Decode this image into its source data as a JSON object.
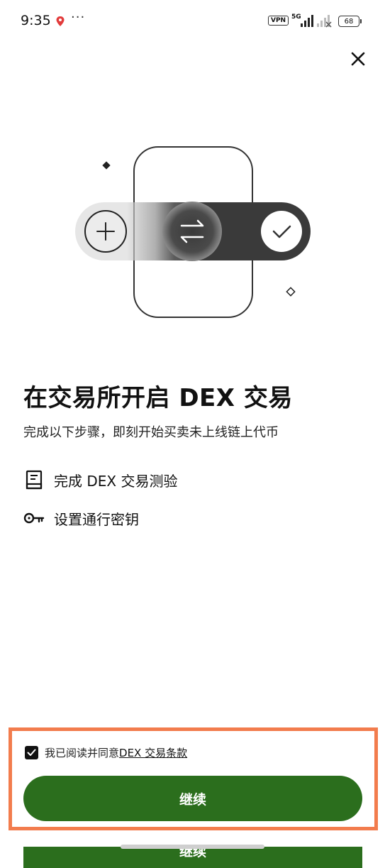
{
  "status_bar": {
    "time": "9:35",
    "dots": "···",
    "vpn_label": "VPN",
    "network_label": "5G",
    "battery": "68"
  },
  "icons": {
    "close": "close-icon",
    "plus": "plus-icon",
    "swap": "swap-arrows-icon",
    "check": "check-icon",
    "quiz": "document-icon",
    "passkey": "key-icon"
  },
  "main": {
    "headline": "在交易所开启 DEX 交易",
    "subtitle": "完成以下步骤，即刻开始买卖未上线链上代币",
    "steps": [
      {
        "label": "完成 DEX 交易测验"
      },
      {
        "label": "设置通行密钥"
      }
    ]
  },
  "footer": {
    "agree_prefix": "我已阅读并同意",
    "agree_link": "DEX 交易条款",
    "agree_checked": true,
    "continue_label": "继续",
    "ghost_label": "继续"
  },
  "colors": {
    "primary_green": "#2b6e1d",
    "highlight_border": "#f27c4d"
  }
}
